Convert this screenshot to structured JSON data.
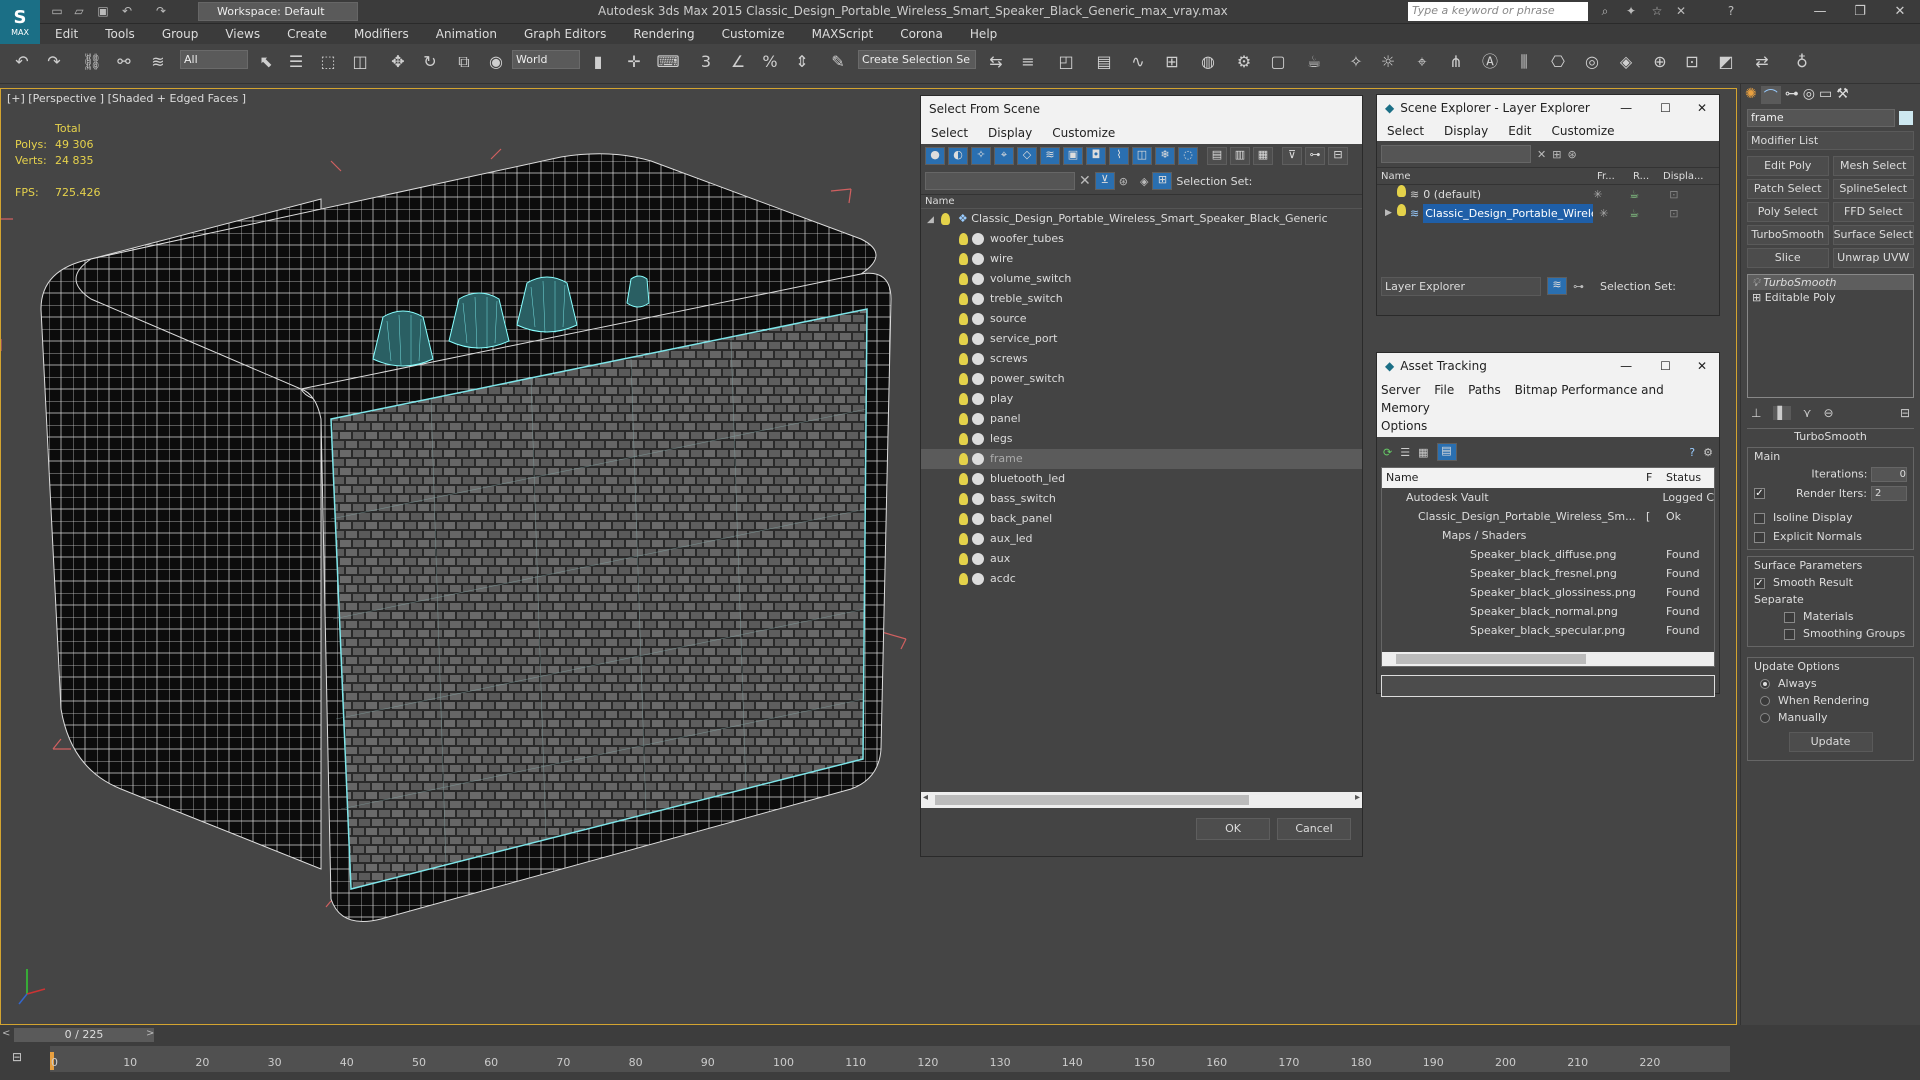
{
  "app": {
    "title": "Autodesk 3ds Max  2015    Classic_Design_Portable_Wireless_Smart_Speaker_Black_Generic_max_vray.max",
    "logo_text": "MAX",
    "workspace": "Workspace: Default",
    "search_placeholder": "Type a keyword or phrase"
  },
  "menubar": [
    "Edit",
    "Tools",
    "Group",
    "Views",
    "Create",
    "Modifiers",
    "Animation",
    "Graph Editors",
    "Rendering",
    "Customize",
    "MAXScript",
    "Corona",
    "Help"
  ],
  "toolbar": {
    "filter": "All",
    "coord_system": "World",
    "selection_set": "Create Selection Se"
  },
  "viewport": {
    "label": "[+] [Perspective ] [Shaded + Edged Faces ]",
    "stats": {
      "total_label": "Total",
      "polys_label": "Polys:",
      "polys": "49 306",
      "verts_label": "Verts:",
      "verts": "24 835",
      "fps_label": "FPS:",
      "fps": "725.426"
    }
  },
  "select_from_scene": {
    "title": "Select From Scene",
    "menu": [
      "Select",
      "Display",
      "Customize"
    ],
    "selection_set_label": "Selection Set:",
    "column_name": "Name",
    "root": "Classic_Design_Portable_Wireless_Smart_Speaker_Black_Generic",
    "items": [
      "woofer_tubes",
      "wire",
      "volume_switch",
      "treble_switch",
      "source",
      "service_port",
      "screws",
      "power_switch",
      "play",
      "panel",
      "legs",
      "frame",
      "bluetooth_led",
      "bass_switch",
      "back_panel",
      "aux_led",
      "aux",
      "acdc"
    ],
    "selected": "frame",
    "ok": "OK",
    "cancel": "Cancel"
  },
  "scene_explorer": {
    "title": "Scene Explorer - Layer Explorer",
    "menu": [
      "Select",
      "Display",
      "Edit",
      "Customize"
    ],
    "columns": [
      "Name",
      "Fr...",
      "R...",
      "Displa..."
    ],
    "rows": [
      "0 (default)",
      "Classic_Design_Portable_Wirele..."
    ],
    "footer_dropdown": "Layer Explorer",
    "selection_set_label": "Selection Set:"
  },
  "asset_tracking": {
    "title": "Asset Tracking",
    "menu": [
      "Server",
      "File",
      "Paths",
      "Bitmap Performance and Memory",
      "Options"
    ],
    "columns": [
      "Name",
      "F",
      "Status"
    ],
    "rows": [
      {
        "name": "Autodesk Vault",
        "f": "",
        "status": "Logged C"
      },
      {
        "name": "Classic_Design_Portable_Wireless_Sm...",
        "f": "[",
        "status": "Ok"
      },
      {
        "name": "Maps / Shaders",
        "f": "",
        "status": ""
      },
      {
        "name": "Speaker_black_diffuse.png",
        "f": "",
        "status": "Found"
      },
      {
        "name": "Speaker_black_fresnel.png",
        "f": "",
        "status": "Found"
      },
      {
        "name": "Speaker_black_glossiness.png",
        "f": "",
        "status": "Found"
      },
      {
        "name": "Speaker_black_normal.png",
        "f": "",
        "status": "Found"
      },
      {
        "name": "Speaker_black_specular.png",
        "f": "",
        "status": "Found"
      }
    ]
  },
  "command_panel": {
    "object_name": "frame",
    "modifier_list": "Modifier List",
    "buttons": [
      "Edit Poly",
      "Mesh Select",
      "Patch Select",
      "SplineSelect",
      "Poly Select",
      "FFD Select",
      "TurboSmooth",
      "Surface Select",
      "Slice",
      "Unwrap UVW"
    ],
    "stack": [
      "TurboSmooth",
      "Editable Poly"
    ],
    "rollout_title": "TurboSmooth",
    "main_label": "Main",
    "iterations_label": "Iterations:",
    "iterations": "0",
    "render_iters_label": "Render Iters:",
    "render_iters": "2",
    "isoline_label": "Isoline Display",
    "explicit_normals_label": "Explicit Normals",
    "surface_params_label": "Surface Parameters",
    "smooth_result_label": "Smooth Result",
    "separate_label": "Separate",
    "materials_label": "Materials",
    "smoothing_groups_label": "Smoothing Groups",
    "update_options_label": "Update Options",
    "always_label": "Always",
    "when_rendering_label": "When Rendering",
    "manually_label": "Manually",
    "update_button": "Update"
  },
  "timeline": {
    "frame": "0 / 225",
    "ticks": [
      "0",
      "10",
      "20",
      "30",
      "40",
      "50",
      "60",
      "70",
      "80",
      "90",
      "100",
      "110",
      "120",
      "130",
      "140",
      "150",
      "160",
      "170",
      "180",
      "190",
      "200",
      "210",
      "220"
    ]
  }
}
